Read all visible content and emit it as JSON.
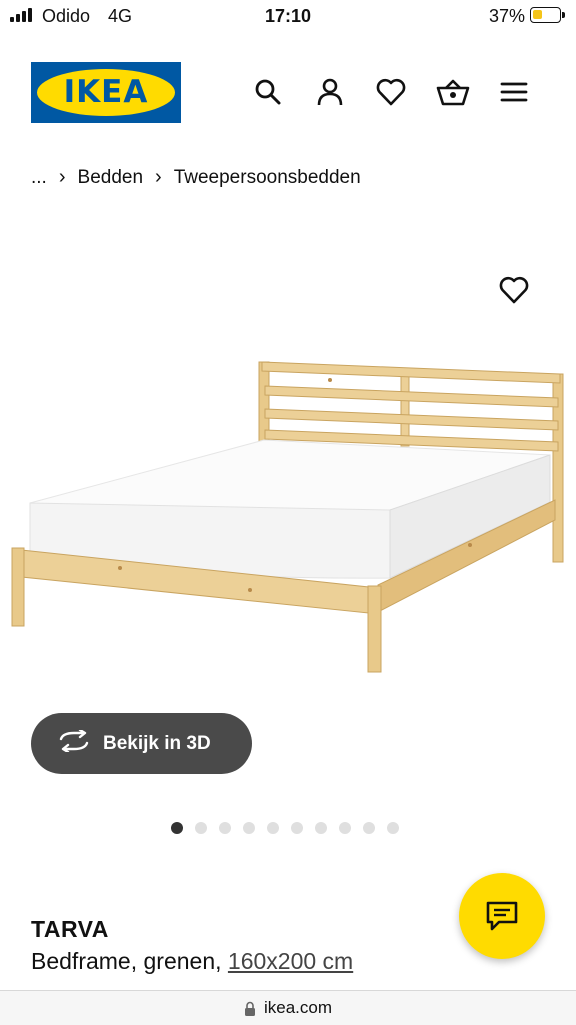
{
  "status_bar": {
    "carrier": "Odido",
    "network": "4G",
    "time": "17:10",
    "battery_percent": "37%",
    "battery_level": 0.37,
    "battery_color": "#f5c518"
  },
  "header": {
    "logo_text": "IKEA",
    "brand_colors": {
      "blue": "#0058a3",
      "yellow": "#ffdb00"
    },
    "icons": [
      "search-icon",
      "user-icon",
      "heart-icon",
      "basket-icon",
      "menu-icon"
    ]
  },
  "breadcrumb": {
    "ellipsis": "...",
    "items": [
      "Bedden",
      "Tweepersoonsbedden"
    ]
  },
  "gallery": {
    "view_3d_label": "Bekijk in 3D",
    "dot_count": 10,
    "active_dot": 0
  },
  "product": {
    "name": "TARVA",
    "description": "Bedframe, grenen, ",
    "size": "160x200 cm"
  },
  "url_bar": {
    "domain": "ikea.com"
  }
}
